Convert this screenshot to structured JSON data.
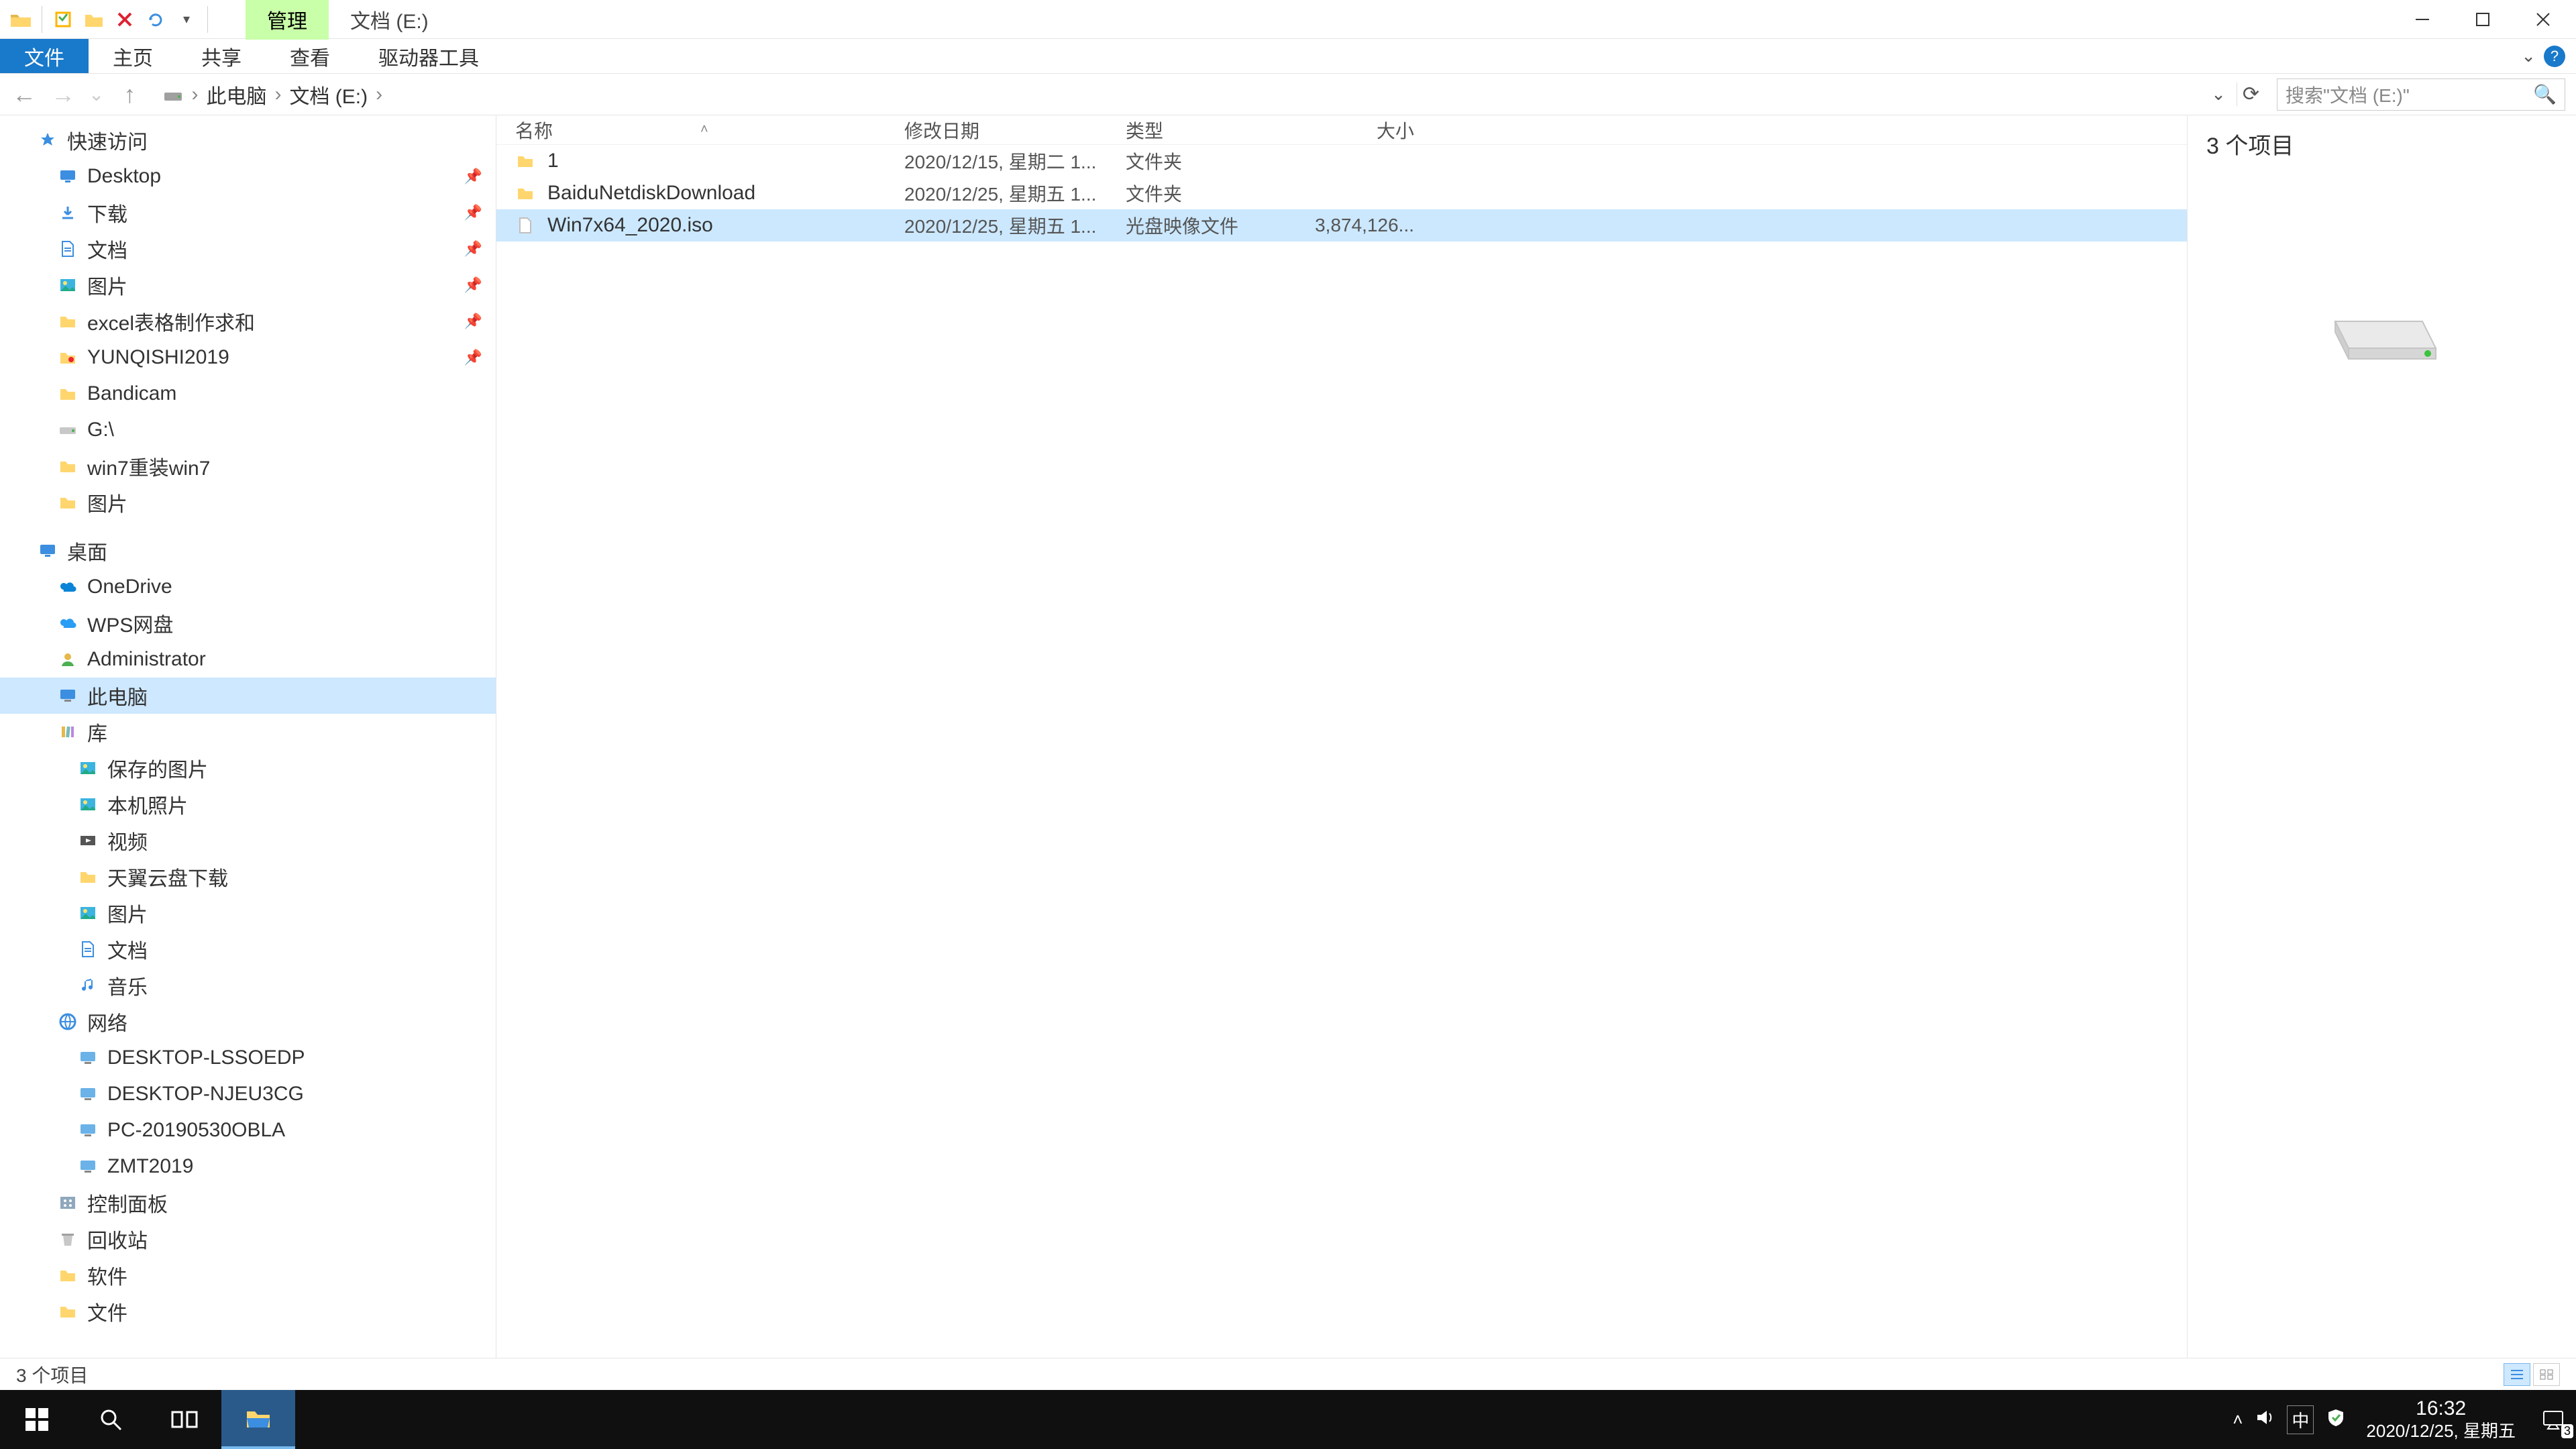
{
  "title": {
    "ribbon_context": "管理",
    "location": "文档 (E:)"
  },
  "ribbon": {
    "file": "文件",
    "home": "主页",
    "share": "共享",
    "view": "查看",
    "drive_tools": "驱动器工具"
  },
  "breadcrumb": {
    "root": "此电脑",
    "drive": "文档 (E:)"
  },
  "search_placeholder": "搜索\"文档 (E:)\"",
  "columns": {
    "name": "名称",
    "date": "修改日期",
    "type": "类型",
    "size": "大小"
  },
  "files": [
    {
      "icon": "folder",
      "name": "1",
      "date": "2020/12/15, 星期二 1...",
      "type": "文件夹",
      "size": ""
    },
    {
      "icon": "folder",
      "name": "BaiduNetdiskDownload",
      "date": "2020/12/25, 星期五 1...",
      "type": "文件夹",
      "size": ""
    },
    {
      "icon": "file",
      "name": "Win7x64_2020.iso",
      "date": "2020/12/25, 星期五 1...",
      "type": "光盘映像文件",
      "size": "3,874,126...",
      "selected": true
    }
  ],
  "tree": {
    "quick_access": "快速访问",
    "quick_items": [
      {
        "icon": "desktop",
        "label": "Desktop",
        "pinned": true
      },
      {
        "icon": "downloads",
        "label": "下载",
        "pinned": true
      },
      {
        "icon": "documents",
        "label": "文档",
        "pinned": true
      },
      {
        "icon": "pictures",
        "label": "图片",
        "pinned": true
      },
      {
        "icon": "folder",
        "label": "excel表格制作求和",
        "pinned": true
      },
      {
        "icon": "folder-app",
        "label": "YUNQISHI2019",
        "pinned": true
      },
      {
        "icon": "folder",
        "label": "Bandicam",
        "pinned": false
      },
      {
        "icon": "drive",
        "label": "G:\\",
        "pinned": false
      },
      {
        "icon": "folder",
        "label": "win7重装win7",
        "pinned": false
      },
      {
        "icon": "folder",
        "label": "图片",
        "pinned": false
      }
    ],
    "desktop_root": "桌面",
    "desktop_items": [
      {
        "icon": "onedrive",
        "label": "OneDrive"
      },
      {
        "icon": "wps",
        "label": "WPS网盘"
      },
      {
        "icon": "user",
        "label": "Administrator"
      },
      {
        "icon": "thispc",
        "label": "此电脑",
        "selected": true
      },
      {
        "icon": "library",
        "label": "库"
      }
    ],
    "library_items": [
      {
        "icon": "pictures",
        "label": "保存的图片"
      },
      {
        "icon": "pictures",
        "label": "本机照片"
      },
      {
        "icon": "video",
        "label": "视频"
      },
      {
        "icon": "folder",
        "label": "天翼云盘下载"
      },
      {
        "icon": "pictures",
        "label": "图片"
      },
      {
        "icon": "documents",
        "label": "文档"
      },
      {
        "icon": "music",
        "label": "音乐"
      }
    ],
    "network": "网络",
    "network_items": [
      {
        "label": "DESKTOP-LSSOEDP"
      },
      {
        "label": "DESKTOP-NJEU3CG"
      },
      {
        "label": "PC-20190530OBLA"
      },
      {
        "label": "ZMT2019"
      }
    ],
    "extra": [
      {
        "icon": "panel",
        "label": "控制面板"
      },
      {
        "icon": "recycle",
        "label": "回收站"
      },
      {
        "icon": "folder",
        "label": "软件"
      },
      {
        "icon": "folder",
        "label": "文件"
      }
    ]
  },
  "preview": {
    "summary": "3 个项目"
  },
  "status": {
    "text": "3 个项目"
  },
  "taskbar": {
    "time": "16:32",
    "date": "2020/12/25, 星期五",
    "ime": "中",
    "notif_count": "3"
  }
}
